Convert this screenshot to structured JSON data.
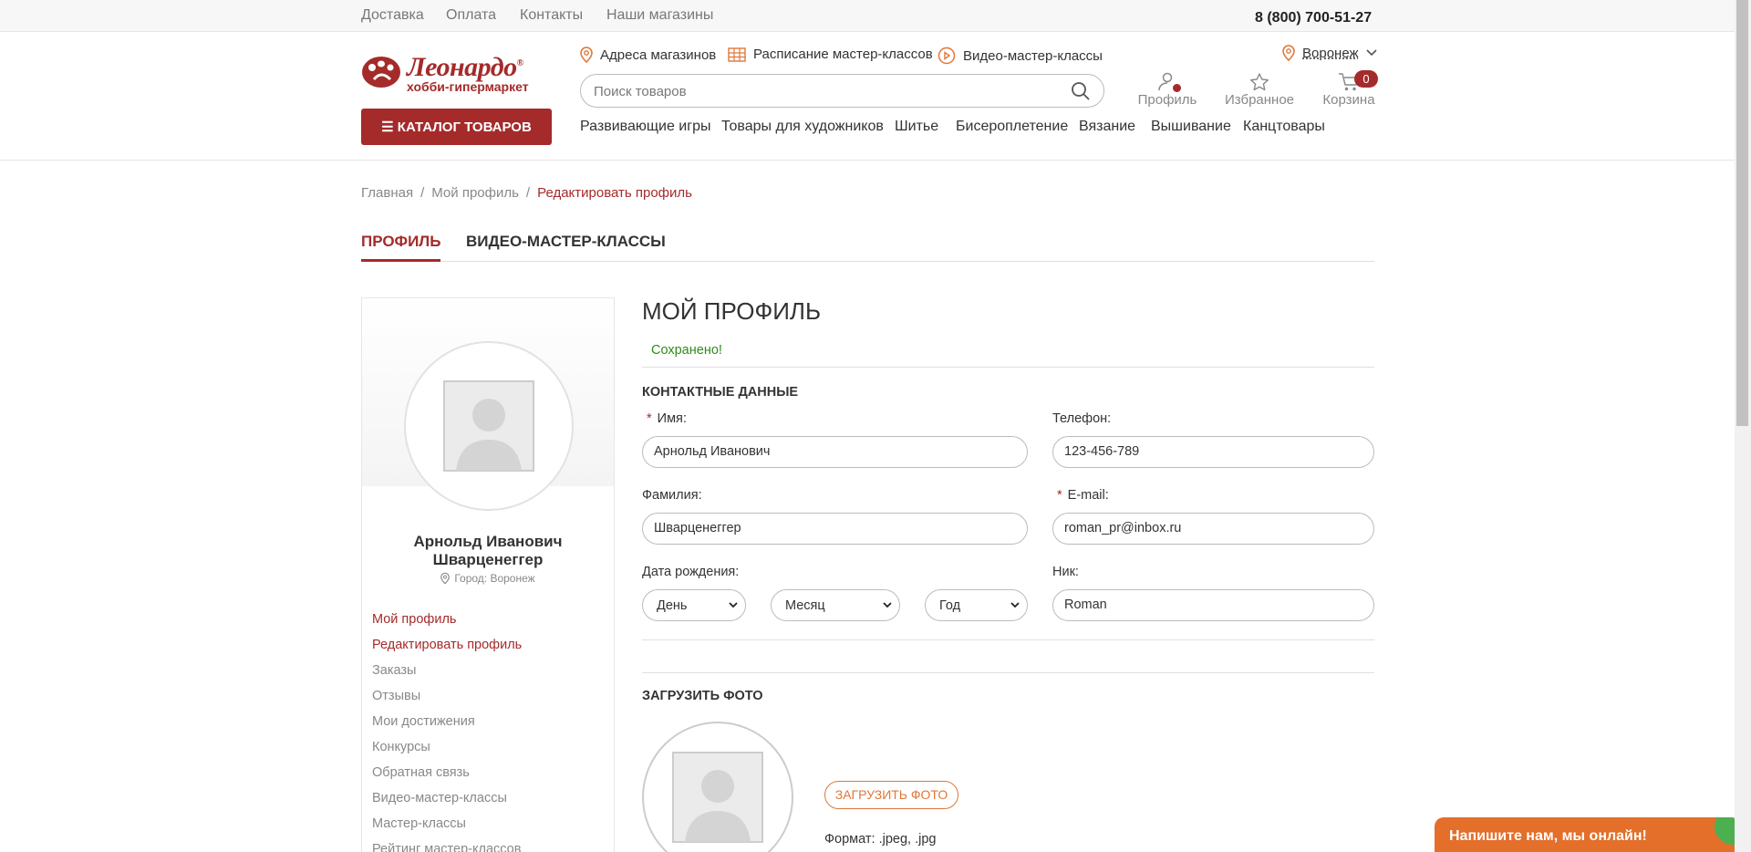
{
  "topbar": {
    "links": [
      "Доставка",
      "Оплата",
      "Контакты",
      "Наши магазины"
    ],
    "phone": "8 (800) 700-51-27"
  },
  "logo": {
    "name": "Леонардо",
    "registered": "®",
    "subtitle": "хобби-гипермаркет"
  },
  "header_links": [
    "Адреса магазинов",
    "Расписание мастер-классов",
    "Видео-мастер-классы"
  ],
  "city": "Воронеж",
  "search": {
    "placeholder": "Поиск товаров"
  },
  "header_icons": {
    "profile": "Профиль",
    "favorites": "Избранное",
    "cart": "Корзина",
    "cart_count": "0"
  },
  "catalog_button": "☰ КАТАЛОГ ТОВАРОВ",
  "nav": [
    "Развивающие игры",
    "Товары для художников",
    "Шитье",
    "Бисероплетение",
    "Вязание",
    "Вышивание",
    "Канцтовары"
  ],
  "breadcrumbs": [
    "Главная",
    "Мой профиль",
    "Редактировать профиль"
  ],
  "breadcrumb_sep": "/",
  "tabs": [
    "Профиль",
    "Видео-мастер-классы"
  ],
  "sidebar": {
    "user_name_line1": "Арнольд Иванович",
    "user_name_line2": "Шварценеггер",
    "city": "Город: Воронеж",
    "menu": [
      "Мой профиль",
      "Редактировать профиль",
      "Заказы",
      "Отзывы",
      "Мои достижения",
      "Конкурсы",
      "Обратная связь",
      "Видео-мастер-классы",
      "Мастер-классы",
      "Рейтинг мастер-классов"
    ]
  },
  "profile": {
    "title": "МОЙ ПРОФИЛЬ",
    "saved_msg": "Сохранено!",
    "contact_section": "Контактные данные",
    "required_mark": "*",
    "labels": {
      "first_name": "Имя:",
      "phone": "Телефон:",
      "last_name": "Фамилия:",
      "email": "E-mail:",
      "birth": "Дата рождения:",
      "nick": "Ник:"
    },
    "values": {
      "first_name": "Арнольд Иванович",
      "phone": "123-456-789",
      "last_name": "Шварценеггер",
      "email": "roman_pr@inbox.ru",
      "nick": "Roman"
    },
    "birth_selects": {
      "day": "День",
      "month": "Месяц",
      "year": "Год"
    },
    "photo_section": "Загрузить фото",
    "upload_button": "Загрузить фото",
    "format": "Формат: .jpeg, .jpg"
  },
  "chat_widget": "Напишите нам, мы онлайн!",
  "colors": {
    "brand": "#a52a2a",
    "accent_orange": "#e0773a",
    "success": "#2e8b1a"
  }
}
